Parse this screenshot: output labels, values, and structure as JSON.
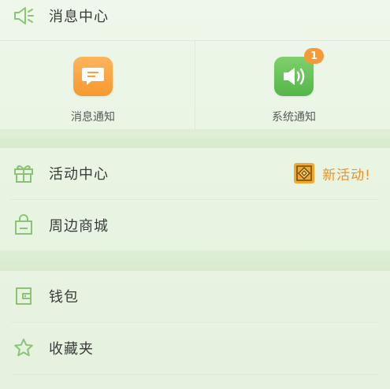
{
  "header": {
    "title": "消息中心",
    "icon": "megaphone-icon"
  },
  "notifications": {
    "items": [
      {
        "label": "消息通知",
        "icon": "chat-bubble-icon",
        "color": "#f7a13b"
      },
      {
        "label": "系统通知",
        "icon": "speaker-icon",
        "color": "#5cbb4f",
        "badge": "1"
      }
    ],
    "badge_color": "#f49a3b"
  },
  "section_activity": {
    "items": [
      {
        "label": "活动中心",
        "icon": "gift-icon",
        "extra": {
          "text": "新活动!",
          "icon": "new-activity-icon",
          "color": "#e8922b"
        }
      },
      {
        "label": "周边商城",
        "icon": "shopping-bag-icon"
      }
    ]
  },
  "section_personal": {
    "items": [
      {
        "label": "钱包",
        "icon": "wallet-icon"
      },
      {
        "label": "收藏夹",
        "icon": "star-icon"
      }
    ]
  },
  "colors": {
    "icon_outline": "#8cc377",
    "background": "#eaf5e4",
    "band": "#d9ecd0"
  }
}
